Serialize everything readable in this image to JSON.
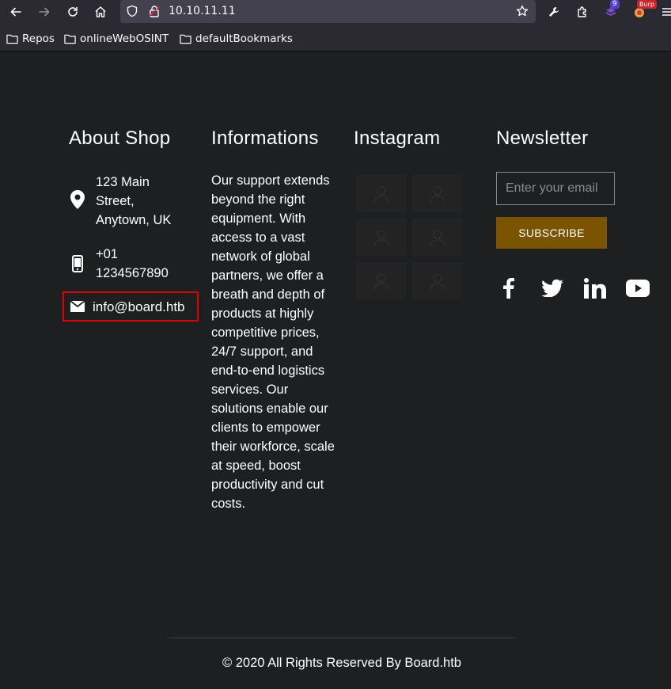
{
  "browser": {
    "url": "10.10.11.11",
    "bookmarks": [
      "Repos",
      "onlineWebOSINT",
      "defaultBookmarks"
    ],
    "extension_badge_count": "9",
    "extension_badge_label": "Burp"
  },
  "footer": {
    "about": {
      "title": "About Shop",
      "address": "123 Main Street, Anytown, UK",
      "phone": "+01 1234567890",
      "email": "info@board.htb"
    },
    "informations": {
      "title": "Informations",
      "text": "Our support extends beyond the right equipment. With access to a vast network of global partners, we offer a breath and depth of products at highly competitive prices, 24/7 support, and end-to-end logistics services. Our solutions enable our clients to empower their workforce, scale at speed, boost productivity and cut costs."
    },
    "instagram": {
      "title": "Instagram",
      "images": [
        "user-icon",
        "user-icon",
        "user-icon",
        "user-icon",
        "user-icon",
        "user-icon"
      ]
    },
    "newsletter": {
      "title": "Newsletter",
      "email_placeholder": "Enter your email",
      "subscribe_label": "SUBSCRIBE",
      "social": [
        "facebook-icon",
        "twitter-icon",
        "linkedin-icon",
        "youtube-icon"
      ]
    },
    "copyright": "© 2020 All Rights Reserved By Board.htb"
  },
  "colors": {
    "background": "#1e1f20",
    "subscribe_button": "#7a5400",
    "highlight_box": "#e00000"
  }
}
